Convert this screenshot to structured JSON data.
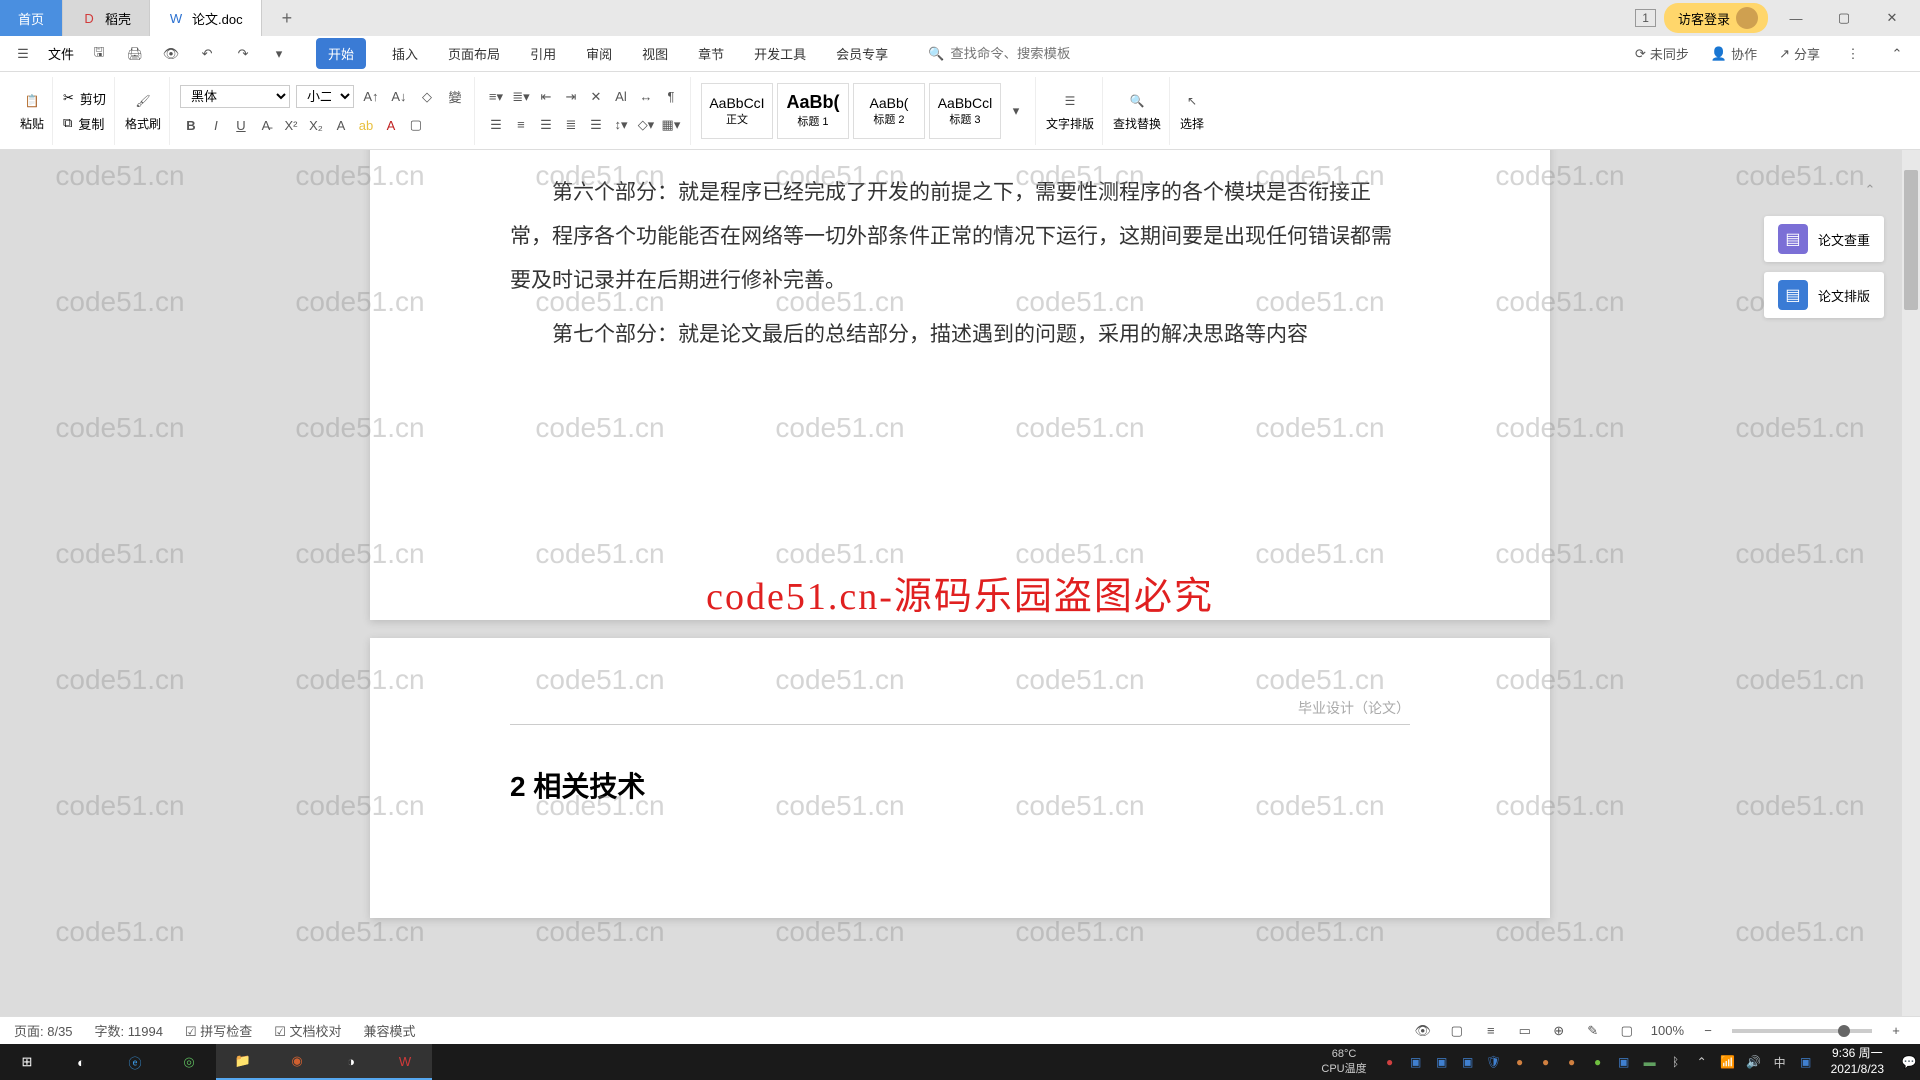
{
  "titlebar": {
    "tabs": [
      {
        "label": "首页",
        "type": "home"
      },
      {
        "label": "稻壳",
        "icon": "D"
      },
      {
        "label": "论文.doc",
        "icon": "W",
        "active": true
      }
    ],
    "badge": "1",
    "login": "访客登录"
  },
  "menubar": {
    "file_label": "文件",
    "tabs": [
      "开始",
      "插入",
      "页面布局",
      "引用",
      "审阅",
      "视图",
      "章节",
      "开发工具",
      "会员专享"
    ],
    "active_tab": "开始",
    "search_placeholder": "查找命令、搜索模板",
    "right": {
      "sync": "未同步",
      "collab": "协作",
      "share": "分享"
    }
  },
  "ribbon": {
    "paste": "粘贴",
    "cut": "剪切",
    "copy": "复制",
    "format_painter": "格式刷",
    "font_name": "黑体",
    "font_size": "小二",
    "styles": {
      "preview": "AaBbCcI",
      "preview_bold": "AaBb(",
      "preview2": "AaBb(",
      "preview3": "AaBbCcl",
      "items": [
        "正文",
        "标题 1",
        "标题 2",
        "标题 3"
      ]
    },
    "text_layout": "文字排版",
    "find_replace": "查找替换",
    "select": "选择"
  },
  "document": {
    "para1": "第六个部分：就是程序已经完成了开发的前提之下，需要性测程序的各个模块是否衔接正常，程序各个功能能否在网络等一切外部条件正常的情况下运行，这期间要是出现任何错误都需要及时记录并在后期进行修补完善。",
    "para2": "第七个部分：就是论文最后的总结部分，描述遇到的问题，采用的解决思路等内容",
    "overlay": "code51.cn-源码乐园盗图必究",
    "page2_header": "毕业设计（论文）",
    "heading": "2 相关技术"
  },
  "side_panel": {
    "item1": "论文查重",
    "item2": "论文排版"
  },
  "statusbar": {
    "page": "页面: 8/35",
    "words": "字数: 11994",
    "spell": "拼写检查",
    "proof": "文档校对",
    "compat": "兼容模式",
    "zoom": "100%"
  },
  "taskbar": {
    "cpu_temp": "68°C",
    "cpu_label": "CPU温度",
    "ime": "中",
    "time": "9:36 周一",
    "date": "2021/8/23"
  },
  "watermark": "code51.cn"
}
